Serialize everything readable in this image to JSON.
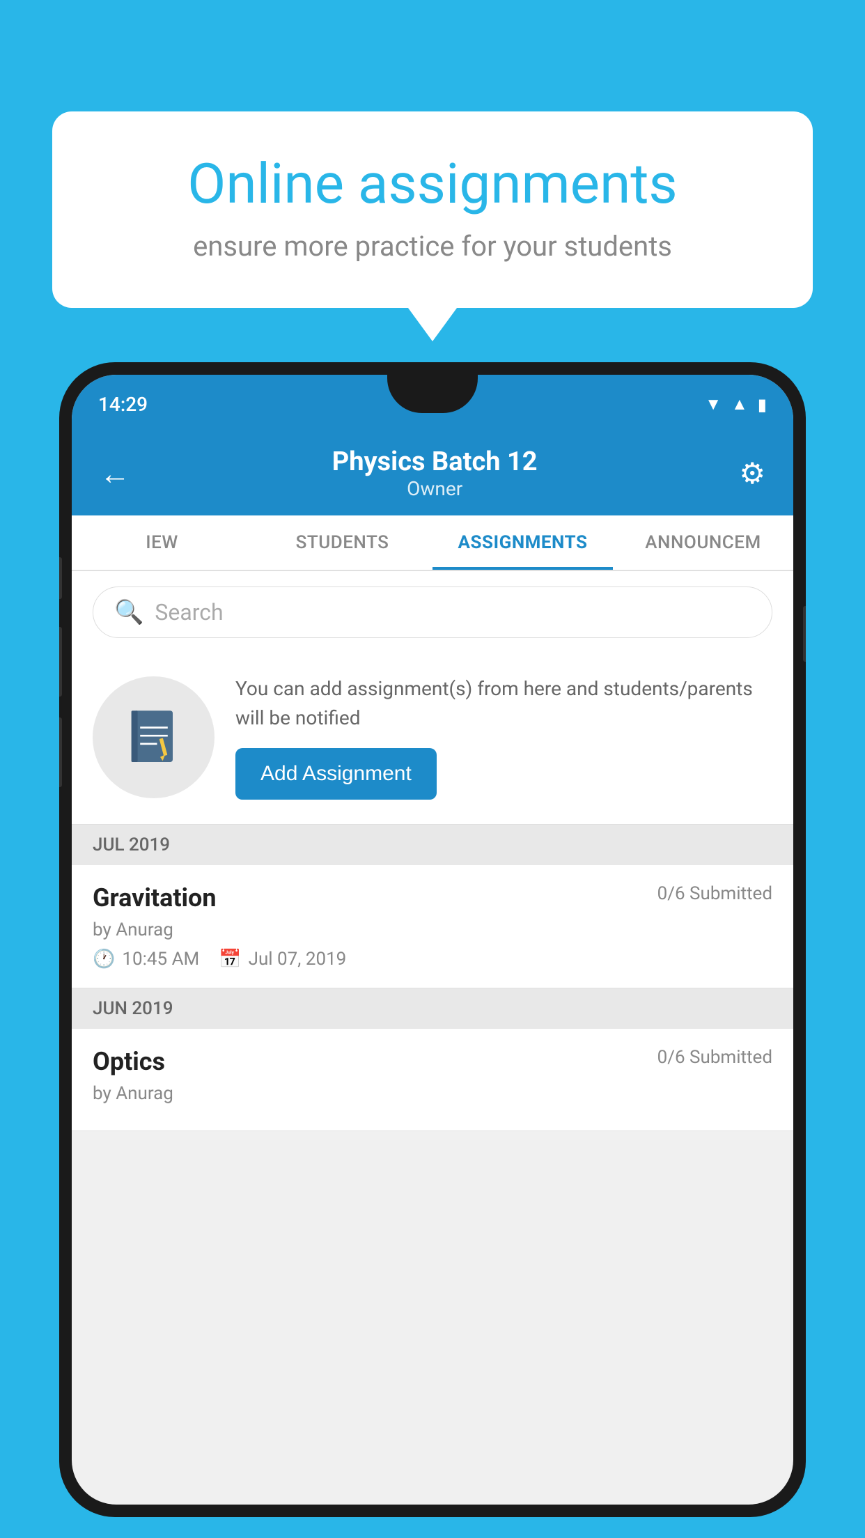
{
  "background_color": "#29b6e8",
  "speech_bubble": {
    "title": "Online assignments",
    "subtitle": "ensure more practice for your students"
  },
  "status_bar": {
    "time": "14:29",
    "icons": [
      "wifi",
      "signal",
      "battery"
    ]
  },
  "app_header": {
    "back_label": "←",
    "title": "Physics Batch 12",
    "subtitle": "Owner",
    "gear_label": "⚙"
  },
  "tabs": [
    {
      "label": "IEW",
      "active": false
    },
    {
      "label": "STUDENTS",
      "active": false
    },
    {
      "label": "ASSIGNMENTS",
      "active": true
    },
    {
      "label": "ANNOUNCEM",
      "active": false
    }
  ],
  "search": {
    "placeholder": "Search"
  },
  "promo": {
    "text": "You can add assignment(s) from here and students/parents will be notified",
    "button_label": "Add Assignment"
  },
  "assignments": {
    "sections": [
      {
        "month_label": "JUL 2019",
        "items": [
          {
            "name": "Gravitation",
            "submitted": "0/6 Submitted",
            "by": "by Anurag",
            "time": "10:45 AM",
            "date": "Jul 07, 2019"
          }
        ]
      },
      {
        "month_label": "JUN 2019",
        "items": [
          {
            "name": "Optics",
            "submitted": "0/6 Submitted",
            "by": "by Anurag",
            "time": "",
            "date": ""
          }
        ]
      }
    ]
  }
}
